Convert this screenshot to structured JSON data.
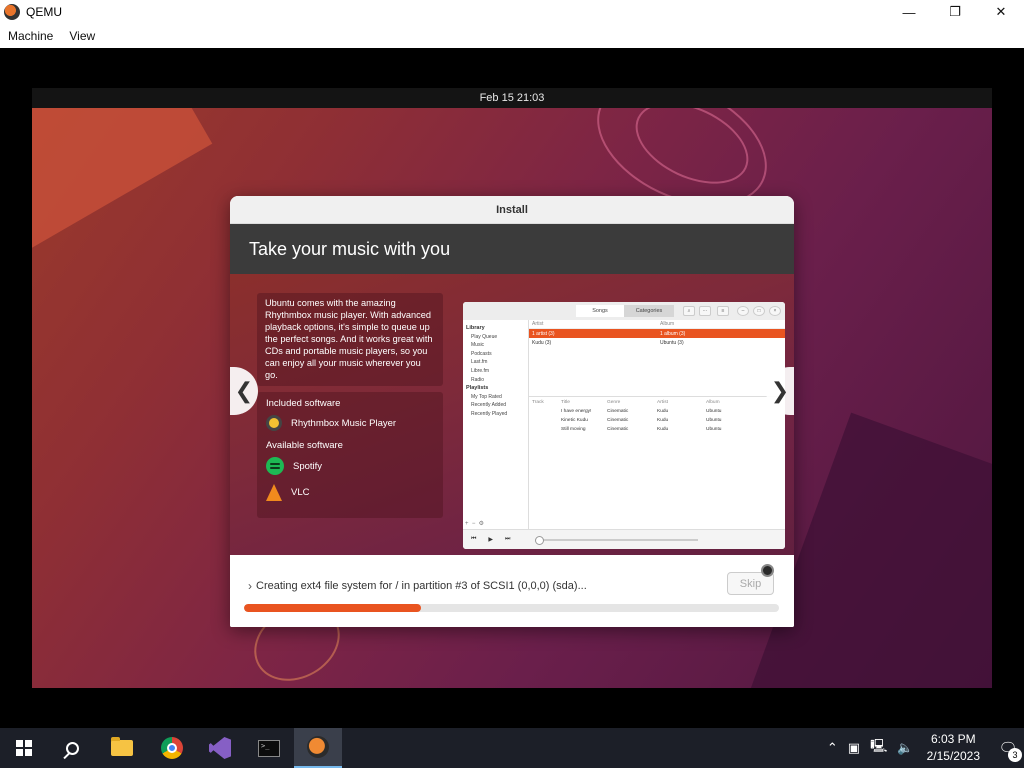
{
  "qemu": {
    "title": "QEMU",
    "controls": {
      "minimize": "—",
      "maximize": "❐",
      "close": "✕"
    },
    "menu": [
      "Machine",
      "View"
    ]
  },
  "gnome": {
    "clock": "Feb 15  21:03"
  },
  "installer": {
    "title": "Install",
    "slide_title": "Take your music with you",
    "description": "Ubuntu comes with the amazing Rhythmbox music player. With advanced playback options, it's simple to queue up the perfect songs. And it works great with CDs and portable music players, so you can enjoy all your music wherever you go.",
    "included_heading": "Included software",
    "included": [
      {
        "label": "Rhythmbox Music Player",
        "icon": "rhythmbox-icon"
      }
    ],
    "available_heading": "Available software",
    "available": [
      {
        "label": "Spotify",
        "icon": "spotify-icon"
      },
      {
        "label": "VLC",
        "icon": "vlc-icon"
      }
    ],
    "nav": {
      "prev": "❮",
      "next": "❯"
    },
    "status": "Creating ext4 file system for / in partition #3 of SCSI1 (0,0,0) (sda)...",
    "status_chevron": "›",
    "skip_label": "Skip",
    "progress_fraction": 0.33,
    "accent": "#e95420"
  },
  "rhythmbox": {
    "tabs": {
      "songs": "Songs",
      "categories": "Categories"
    },
    "library_heading": "Library",
    "library": [
      "Play Queue",
      "Music",
      "Podcasts",
      "Last.fm",
      "Libre.fm",
      "Radio"
    ],
    "playlists_heading": "Playlists",
    "playlists": [
      "My Top Rated",
      "Recently Added",
      "Recently Played"
    ],
    "artist_header": "Artist",
    "album_header": "Album",
    "artist_rows": [
      "1 artist (3)",
      "Kudu (3)"
    ],
    "album_rows": [
      "1 album (3)",
      "Ubuntu (3)"
    ],
    "track_headers": [
      "Track",
      "Title",
      "Genre",
      "Artist",
      "Album"
    ],
    "tracks": [
      {
        "title": "I have energy!",
        "genre": "Cinematic",
        "artist": "Kudu",
        "album": "Ubuntu"
      },
      {
        "title": "Kinetic Kudu",
        "genre": "Cinematic",
        "artist": "Kudu",
        "album": "Ubuntu"
      },
      {
        "title": "Still moving",
        "genre": "Cinematic",
        "artist": "Kudu",
        "album": "Ubuntu"
      }
    ],
    "controls": {
      "prev": "⏮",
      "play": "▶",
      "next": "⏭"
    }
  },
  "taskbar": {
    "apps": [
      {
        "name": "start-button",
        "icon": "windows-icon"
      },
      {
        "name": "search-button",
        "icon": "search-icon"
      },
      {
        "name": "file-explorer",
        "icon": "folder-icon"
      },
      {
        "name": "chrome",
        "icon": "chrome-icon"
      },
      {
        "name": "visual-studio",
        "icon": "visual-studio-icon"
      },
      {
        "name": "terminal",
        "icon": "terminal-icon"
      },
      {
        "name": "qemu",
        "icon": "qemu-icon"
      }
    ],
    "tray": {
      "chevron": "⌃",
      "time": "6:03 PM",
      "date": "2/15/2023",
      "notifications_count": "3"
    }
  }
}
